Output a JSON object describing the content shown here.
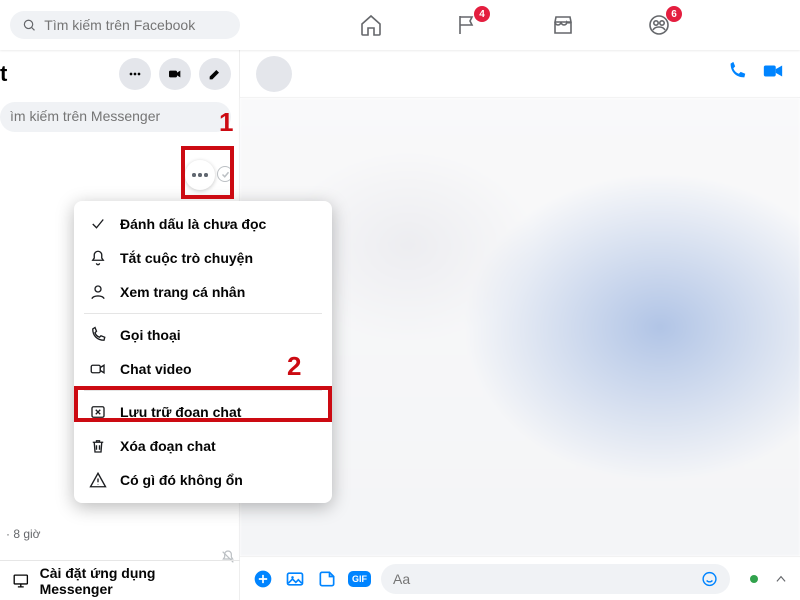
{
  "topbar": {
    "search_placeholder": "Tìm kiếm trên Facebook",
    "badges": {
      "flag": "4",
      "groups": "6"
    }
  },
  "sidebar": {
    "title_suffix": "t",
    "messenger_search_placeholder": "ìm kiếm trên Messenger",
    "install_label": "Cài đặt ứng dụng Messenger",
    "last_line": "· 8 giờ"
  },
  "menu": {
    "items": [
      "Đánh dấu là chưa đọc",
      "Tắt cuộc trò chuyện",
      "Xem trang cá nhân",
      "Gọi thoại",
      "Chat video",
      "Lưu trữ đoạn chat",
      "Xóa đoạn chat",
      "Có gì đó không ổn"
    ]
  },
  "composer": {
    "placeholder": "Aa",
    "gif_label": "GIF"
  },
  "annotations": {
    "step1": "1",
    "step2": "2"
  }
}
